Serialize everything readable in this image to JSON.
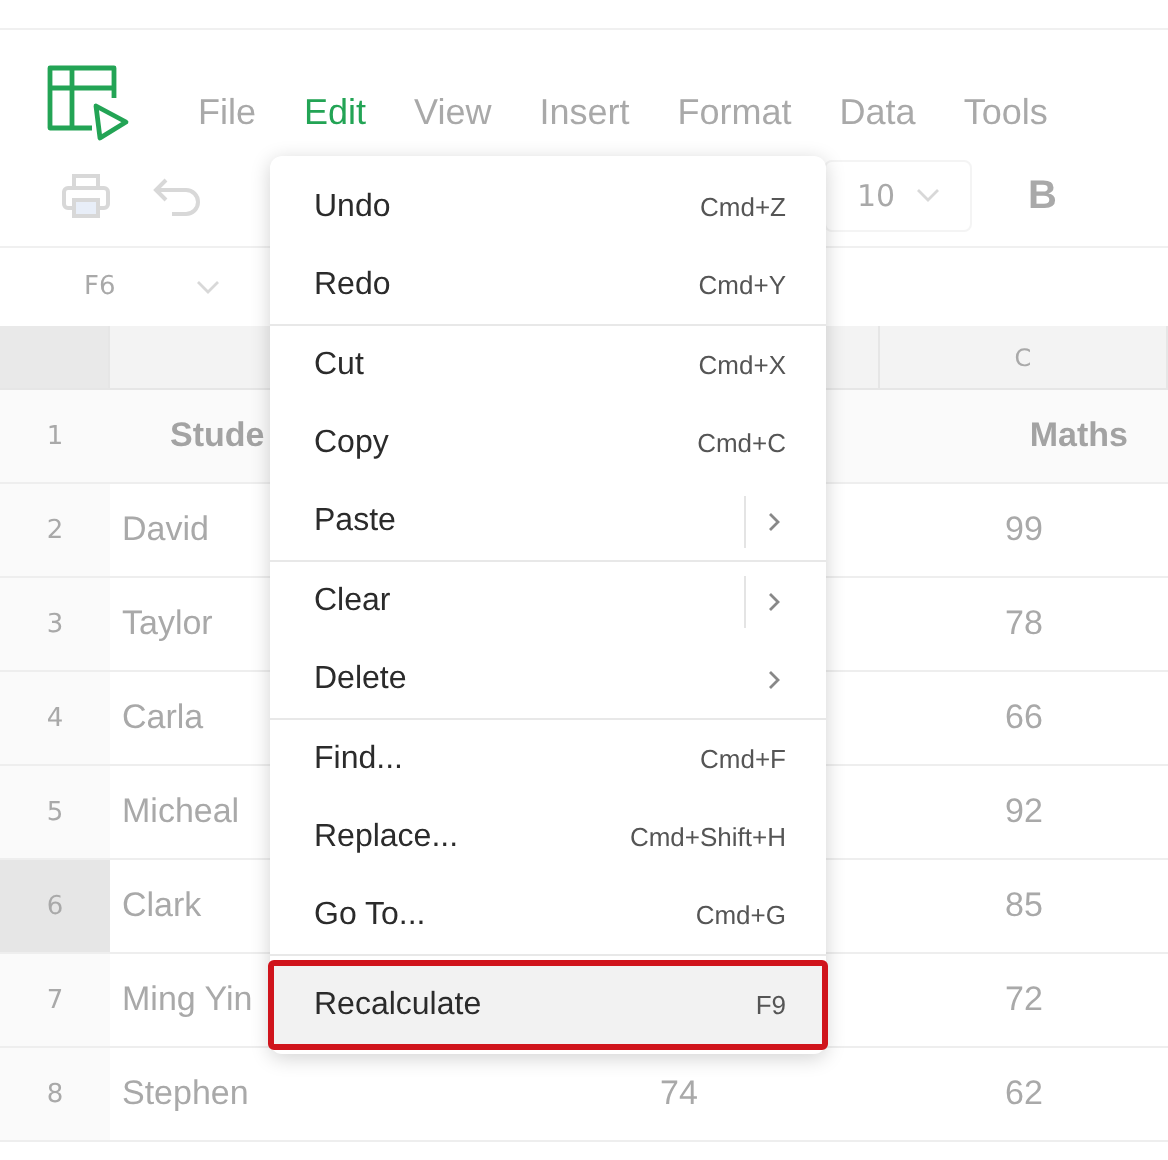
{
  "menubar": [
    {
      "label": "File",
      "selected": false
    },
    {
      "label": "Edit",
      "selected": true
    },
    {
      "label": "View",
      "selected": false
    },
    {
      "label": "Insert",
      "selected": false
    },
    {
      "label": "Format",
      "selected": false
    },
    {
      "label": "Data",
      "selected": false
    },
    {
      "label": "Tools",
      "selected": false
    }
  ],
  "toolbar": {
    "font_size": "10",
    "bold": "B"
  },
  "name_box": "F6",
  "column_header": "C",
  "rows": [
    {
      "number": "1",
      "name": "Stude",
      "maths": "Maths",
      "kind": "header",
      "selected": false
    },
    {
      "number": "2",
      "name": "David",
      "maths": "99",
      "kind": "data",
      "selected": false
    },
    {
      "number": "3",
      "name": "Taylor",
      "maths": "78",
      "kind": "data",
      "selected": false
    },
    {
      "number": "4",
      "name": "Carla",
      "maths": "66",
      "kind": "data",
      "selected": false
    },
    {
      "number": "5",
      "name": "Micheal",
      "maths": "92",
      "kind": "data",
      "selected": false
    },
    {
      "number": "6",
      "name": "Clark",
      "maths": "85",
      "kind": "data",
      "selected": true
    },
    {
      "number": "7",
      "name": "Ming Yin",
      "maths": "72",
      "kind": "data",
      "selected": false
    },
    {
      "number": "8",
      "name": "Stephen",
      "score": "74",
      "maths": "62",
      "kind": "data",
      "selected": false
    }
  ],
  "edit_menu": [
    [
      {
        "label": "Undo",
        "shortcut": "Cmd+Z",
        "kind": "command",
        "selected": false
      },
      {
        "label": "Redo",
        "shortcut": "Cmd+Y",
        "kind": "command",
        "selected": false
      }
    ],
    [
      {
        "label": "Cut",
        "shortcut": "Cmd+X",
        "kind": "command",
        "selected": false
      },
      {
        "label": "Copy",
        "shortcut": "Cmd+C",
        "kind": "command",
        "selected": false
      },
      {
        "label": "Paste",
        "kind": "split-submenu",
        "selected": false
      }
    ],
    [
      {
        "label": "Clear",
        "kind": "split-submenu",
        "selected": false
      },
      {
        "label": "Delete",
        "kind": "submenu",
        "selected": false
      }
    ],
    [
      {
        "label": "Find...",
        "shortcut": "Cmd+F",
        "kind": "command",
        "selected": false
      },
      {
        "label": "Replace...",
        "shortcut": "Cmd+Shift+H",
        "kind": "command",
        "selected": false
      },
      {
        "label": "Go To...",
        "shortcut": "Cmd+G",
        "kind": "command",
        "selected": false
      }
    ],
    [
      {
        "label": "Recalculate",
        "shortcut": "F9",
        "kind": "command",
        "selected": true
      }
    ]
  ]
}
